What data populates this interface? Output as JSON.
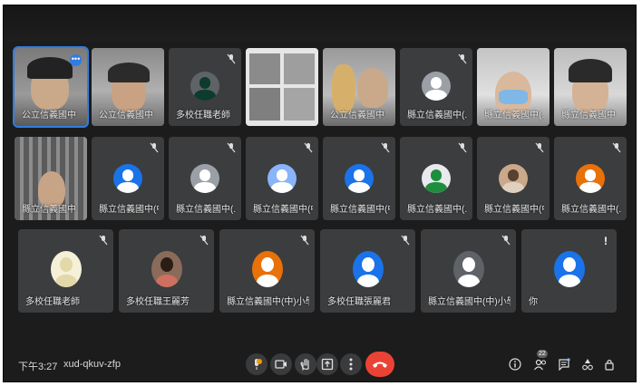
{
  "meeting": {
    "time": "下午3:27",
    "code": "xud-qkuv-zfp",
    "participant_count": "22"
  },
  "tiles": [
    {
      "name": "公立信義國中",
      "kind": "video",
      "muted": false
    },
    {
      "name": "公立信義國中",
      "kind": "video",
      "muted": false
    },
    {
      "name": "多校任職老師",
      "kind": "avatar",
      "muted": true
    },
    {
      "name": "",
      "kind": "video",
      "muted": false
    },
    {
      "name": "公立信義國中",
      "kind": "video",
      "muted": false
    },
    {
      "name": "縣立信義國中(...",
      "kind": "avatar",
      "muted": true
    },
    {
      "name": "縣立信義國中(...",
      "kind": "video",
      "muted": false
    },
    {
      "name": "縣立信義國中",
      "kind": "video",
      "muted": false
    },
    {
      "name": "縣立信義國中",
      "kind": "video",
      "muted": false
    },
    {
      "name": "縣立信義國中(中)...",
      "kind": "avatar",
      "muted": true
    },
    {
      "name": "縣立信義國中(...",
      "kind": "avatar",
      "muted": true
    },
    {
      "name": "縣立信義國中(中)...",
      "kind": "avatar",
      "muted": true
    },
    {
      "name": "縣立信義國中(中)...",
      "kind": "avatar",
      "muted": true
    },
    {
      "name": "縣立信義國中(...",
      "kind": "photo",
      "muted": true
    },
    {
      "name": "縣立信義國中(中)...",
      "kind": "photo",
      "muted": true
    },
    {
      "name": "縣立信義國中(...",
      "kind": "avatar",
      "muted": true
    },
    {
      "name": "多校任職老師",
      "kind": "photo",
      "muted": true
    },
    {
      "name": "多校任職王麗芳",
      "kind": "photo",
      "muted": true
    },
    {
      "name": "縣立信義國中(中)小學教師",
      "kind": "avatar",
      "muted": true
    },
    {
      "name": "多校任職張麗君",
      "kind": "avatar",
      "muted": true
    },
    {
      "name": "縣立信義國中(中)小學教師",
      "kind": "avatar",
      "muted": true
    },
    {
      "name": "你",
      "kind": "avatar",
      "muted": false
    }
  ],
  "colors": {
    "tile_bg": "#3c3d3f",
    "avatar_blue": "#1a73e8",
    "avatar_orange": "#e8710a",
    "avatar_gray": "#5f6368",
    "end_call": "#ea4335",
    "active_outline": "#2f7de1"
  },
  "controls": {
    "mic_icon": "mic-icon",
    "camera_icon": "camera-icon",
    "hand_icon": "raise-hand-icon",
    "present_icon": "present-icon",
    "more_icon": "more-options-icon",
    "end_icon": "end-call-icon",
    "info_icon": "info-icon",
    "people_icon": "people-icon",
    "chat_icon": "chat-icon",
    "activities_icon": "activities-icon",
    "lock_icon": "host-controls-icon"
  }
}
